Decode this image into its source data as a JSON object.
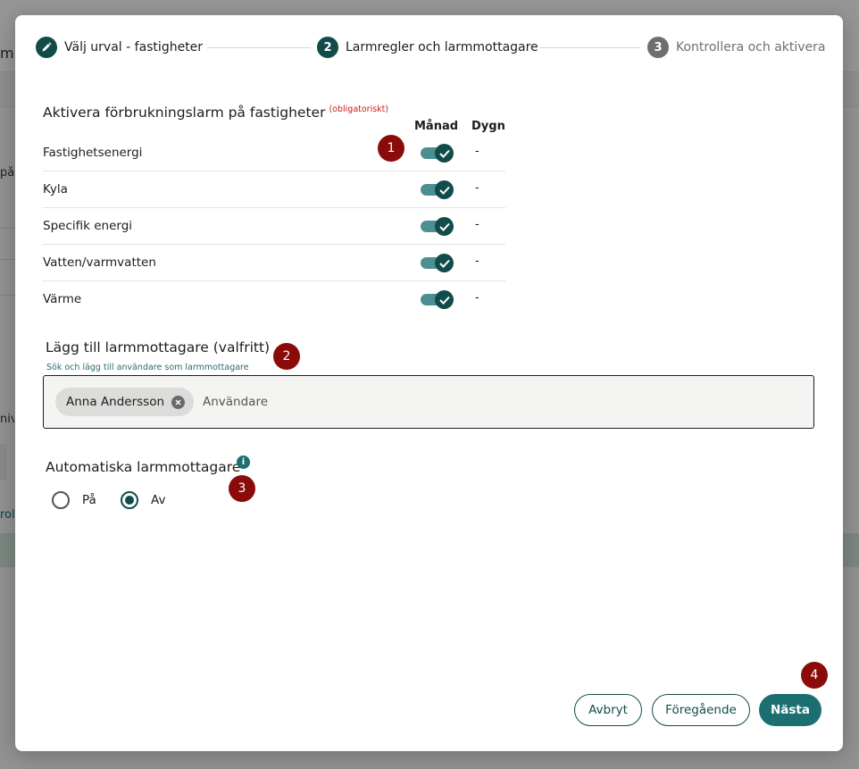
{
  "stepper": {
    "steps": [
      {
        "label": "Välj urval - fastigheter",
        "state": "done"
      },
      {
        "number": "2",
        "label": "Larmregler och larmmottagare",
        "state": "active"
      },
      {
        "number": "3",
        "label": "Kontrollera och aktivera",
        "state": "upcoming"
      }
    ]
  },
  "consumption_alarms": {
    "title": "Aktivera förbrukningslarm på fastigheter",
    "required_label": "(obligatoriskt)",
    "column_month": "Månad",
    "column_day": "Dygn",
    "rows": [
      {
        "label": "Fastighetsenergi",
        "month_enabled": true,
        "day_value": "-"
      },
      {
        "label": "Kyla",
        "month_enabled": true,
        "day_value": "-"
      },
      {
        "label": "Specifik energi",
        "month_enabled": true,
        "day_value": "-"
      },
      {
        "label": "Vatten/varmvatten",
        "month_enabled": true,
        "day_value": "-"
      },
      {
        "label": "Värme",
        "month_enabled": true,
        "day_value": "-"
      }
    ]
  },
  "recipients": {
    "title": "Lägg till larmmottagare (valfritt)",
    "help_text": "Sök och lägg till användare som larmmottagare",
    "selected_users": [
      "Anna Andersson"
    ],
    "input_placeholder": "Användare"
  },
  "auto_recipients": {
    "title": "Automatiska larmmottagare",
    "info_icon": "i",
    "options": [
      {
        "label": "På",
        "selected": false
      },
      {
        "label": "Av",
        "selected": true
      }
    ]
  },
  "annotations": {
    "badges": [
      "1",
      "2",
      "3",
      "4"
    ]
  },
  "footer": {
    "cancel_label": "Avbryt",
    "previous_label": "Föregående",
    "next_label": "Nästa"
  },
  "colors": {
    "primary": "#124c4a",
    "accent": "#1b6f71",
    "toggle_track": "#4b8f93",
    "badge": "#8b0b0b",
    "required": "#d11a1a"
  },
  "background_page": {
    "fragments": [
      "m",
      "på f",
      "niv",
      "roll"
    ]
  }
}
